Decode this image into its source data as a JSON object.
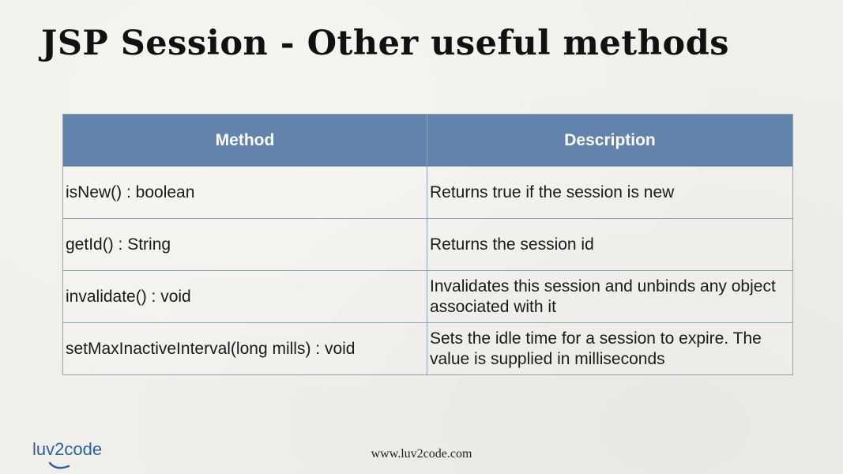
{
  "slide": {
    "title": "JSP Session - Other useful methods",
    "footer_url": "www.luv2code.com",
    "logo_text": "luv2code",
    "colors": {
      "header_bg": "#6283ac",
      "header_text": "#ffffff",
      "border": "#8da1b8",
      "background": "#f1efea",
      "logo": "#2c5f9e"
    }
  },
  "table": {
    "headers": [
      "Method",
      "Description"
    ],
    "rows": [
      [
        "isNew() : boolean",
        "Returns true if the session is new"
      ],
      [
        "getId() : String",
        "Returns the session id"
      ],
      [
        "invalidate() : void",
        "Invalidates this session and unbinds any object associated with it"
      ],
      [
        "setMaxInactiveInterval(long mills) : void",
        "Sets the idle time for a session to expire. The value is supplied in milliseconds"
      ]
    ]
  }
}
